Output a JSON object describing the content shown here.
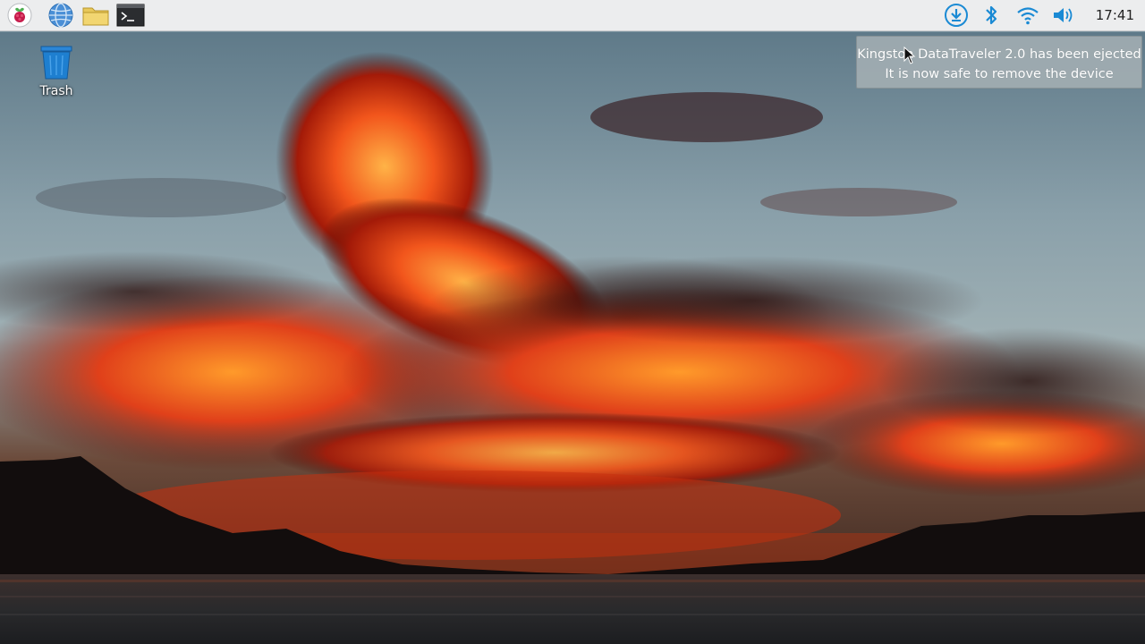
{
  "taskbar": {
    "launchers": [
      {
        "name": "raspberry-menu-icon"
      },
      {
        "name": "web-browser-icon"
      },
      {
        "name": "file-manager-icon"
      },
      {
        "name": "terminal-icon"
      }
    ],
    "tray": [
      {
        "name": "download-updates-icon"
      },
      {
        "name": "bluetooth-icon"
      },
      {
        "name": "wifi-icon"
      },
      {
        "name": "volume-icon"
      }
    ],
    "clock": "17:41"
  },
  "desktop": {
    "icons": [
      {
        "name": "trash-icon",
        "label": "Trash"
      }
    ]
  },
  "notification": {
    "line1": "Kingston DataTraveler 2.0 has been ejected",
    "line2": "It is now safe to remove the device"
  },
  "colors": {
    "taskbar_bg": "#ecedee",
    "tray_blue": "#1a8ad4",
    "trash_blue": "#1e7fd0"
  }
}
